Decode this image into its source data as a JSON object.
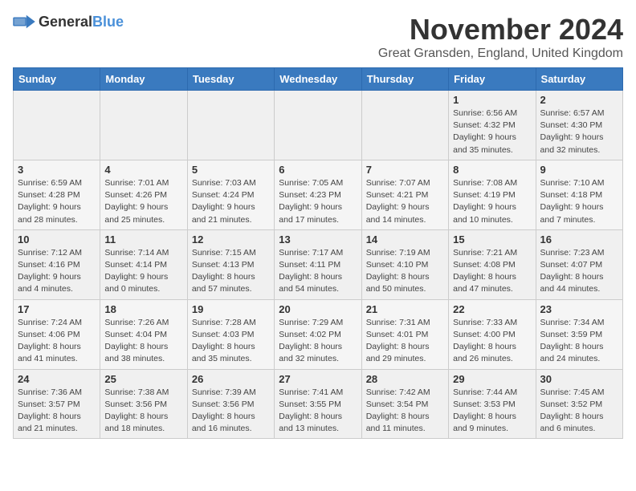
{
  "logo": {
    "general": "General",
    "blue": "Blue"
  },
  "title": "November 2024",
  "location": "Great Gransden, England, United Kingdom",
  "days_of_week": [
    "Sunday",
    "Monday",
    "Tuesday",
    "Wednesday",
    "Thursday",
    "Friday",
    "Saturday"
  ],
  "weeks": [
    [
      {
        "day": "",
        "info": ""
      },
      {
        "day": "",
        "info": ""
      },
      {
        "day": "",
        "info": ""
      },
      {
        "day": "",
        "info": ""
      },
      {
        "day": "",
        "info": ""
      },
      {
        "day": "1",
        "info": "Sunrise: 6:56 AM\nSunset: 4:32 PM\nDaylight: 9 hours and 35 minutes."
      },
      {
        "day": "2",
        "info": "Sunrise: 6:57 AM\nSunset: 4:30 PM\nDaylight: 9 hours and 32 minutes."
      }
    ],
    [
      {
        "day": "3",
        "info": "Sunrise: 6:59 AM\nSunset: 4:28 PM\nDaylight: 9 hours and 28 minutes."
      },
      {
        "day": "4",
        "info": "Sunrise: 7:01 AM\nSunset: 4:26 PM\nDaylight: 9 hours and 25 minutes."
      },
      {
        "day": "5",
        "info": "Sunrise: 7:03 AM\nSunset: 4:24 PM\nDaylight: 9 hours and 21 minutes."
      },
      {
        "day": "6",
        "info": "Sunrise: 7:05 AM\nSunset: 4:23 PM\nDaylight: 9 hours and 17 minutes."
      },
      {
        "day": "7",
        "info": "Sunrise: 7:07 AM\nSunset: 4:21 PM\nDaylight: 9 hours and 14 minutes."
      },
      {
        "day": "8",
        "info": "Sunrise: 7:08 AM\nSunset: 4:19 PM\nDaylight: 9 hours and 10 minutes."
      },
      {
        "day": "9",
        "info": "Sunrise: 7:10 AM\nSunset: 4:18 PM\nDaylight: 9 hours and 7 minutes."
      }
    ],
    [
      {
        "day": "10",
        "info": "Sunrise: 7:12 AM\nSunset: 4:16 PM\nDaylight: 9 hours and 4 minutes."
      },
      {
        "day": "11",
        "info": "Sunrise: 7:14 AM\nSunset: 4:14 PM\nDaylight: 9 hours and 0 minutes."
      },
      {
        "day": "12",
        "info": "Sunrise: 7:15 AM\nSunset: 4:13 PM\nDaylight: 8 hours and 57 minutes."
      },
      {
        "day": "13",
        "info": "Sunrise: 7:17 AM\nSunset: 4:11 PM\nDaylight: 8 hours and 54 minutes."
      },
      {
        "day": "14",
        "info": "Sunrise: 7:19 AM\nSunset: 4:10 PM\nDaylight: 8 hours and 50 minutes."
      },
      {
        "day": "15",
        "info": "Sunrise: 7:21 AM\nSunset: 4:08 PM\nDaylight: 8 hours and 47 minutes."
      },
      {
        "day": "16",
        "info": "Sunrise: 7:23 AM\nSunset: 4:07 PM\nDaylight: 8 hours and 44 minutes."
      }
    ],
    [
      {
        "day": "17",
        "info": "Sunrise: 7:24 AM\nSunset: 4:06 PM\nDaylight: 8 hours and 41 minutes."
      },
      {
        "day": "18",
        "info": "Sunrise: 7:26 AM\nSunset: 4:04 PM\nDaylight: 8 hours and 38 minutes."
      },
      {
        "day": "19",
        "info": "Sunrise: 7:28 AM\nSunset: 4:03 PM\nDaylight: 8 hours and 35 minutes."
      },
      {
        "day": "20",
        "info": "Sunrise: 7:29 AM\nSunset: 4:02 PM\nDaylight: 8 hours and 32 minutes."
      },
      {
        "day": "21",
        "info": "Sunrise: 7:31 AM\nSunset: 4:01 PM\nDaylight: 8 hours and 29 minutes."
      },
      {
        "day": "22",
        "info": "Sunrise: 7:33 AM\nSunset: 4:00 PM\nDaylight: 8 hours and 26 minutes."
      },
      {
        "day": "23",
        "info": "Sunrise: 7:34 AM\nSunset: 3:59 PM\nDaylight: 8 hours and 24 minutes."
      }
    ],
    [
      {
        "day": "24",
        "info": "Sunrise: 7:36 AM\nSunset: 3:57 PM\nDaylight: 8 hours and 21 minutes."
      },
      {
        "day": "25",
        "info": "Sunrise: 7:38 AM\nSunset: 3:56 PM\nDaylight: 8 hours and 18 minutes."
      },
      {
        "day": "26",
        "info": "Sunrise: 7:39 AM\nSunset: 3:56 PM\nDaylight: 8 hours and 16 minutes."
      },
      {
        "day": "27",
        "info": "Sunrise: 7:41 AM\nSunset: 3:55 PM\nDaylight: 8 hours and 13 minutes."
      },
      {
        "day": "28",
        "info": "Sunrise: 7:42 AM\nSunset: 3:54 PM\nDaylight: 8 hours and 11 minutes."
      },
      {
        "day": "29",
        "info": "Sunrise: 7:44 AM\nSunset: 3:53 PM\nDaylight: 8 hours and 9 minutes."
      },
      {
        "day": "30",
        "info": "Sunrise: 7:45 AM\nSunset: 3:52 PM\nDaylight: 8 hours and 6 minutes."
      }
    ]
  ]
}
